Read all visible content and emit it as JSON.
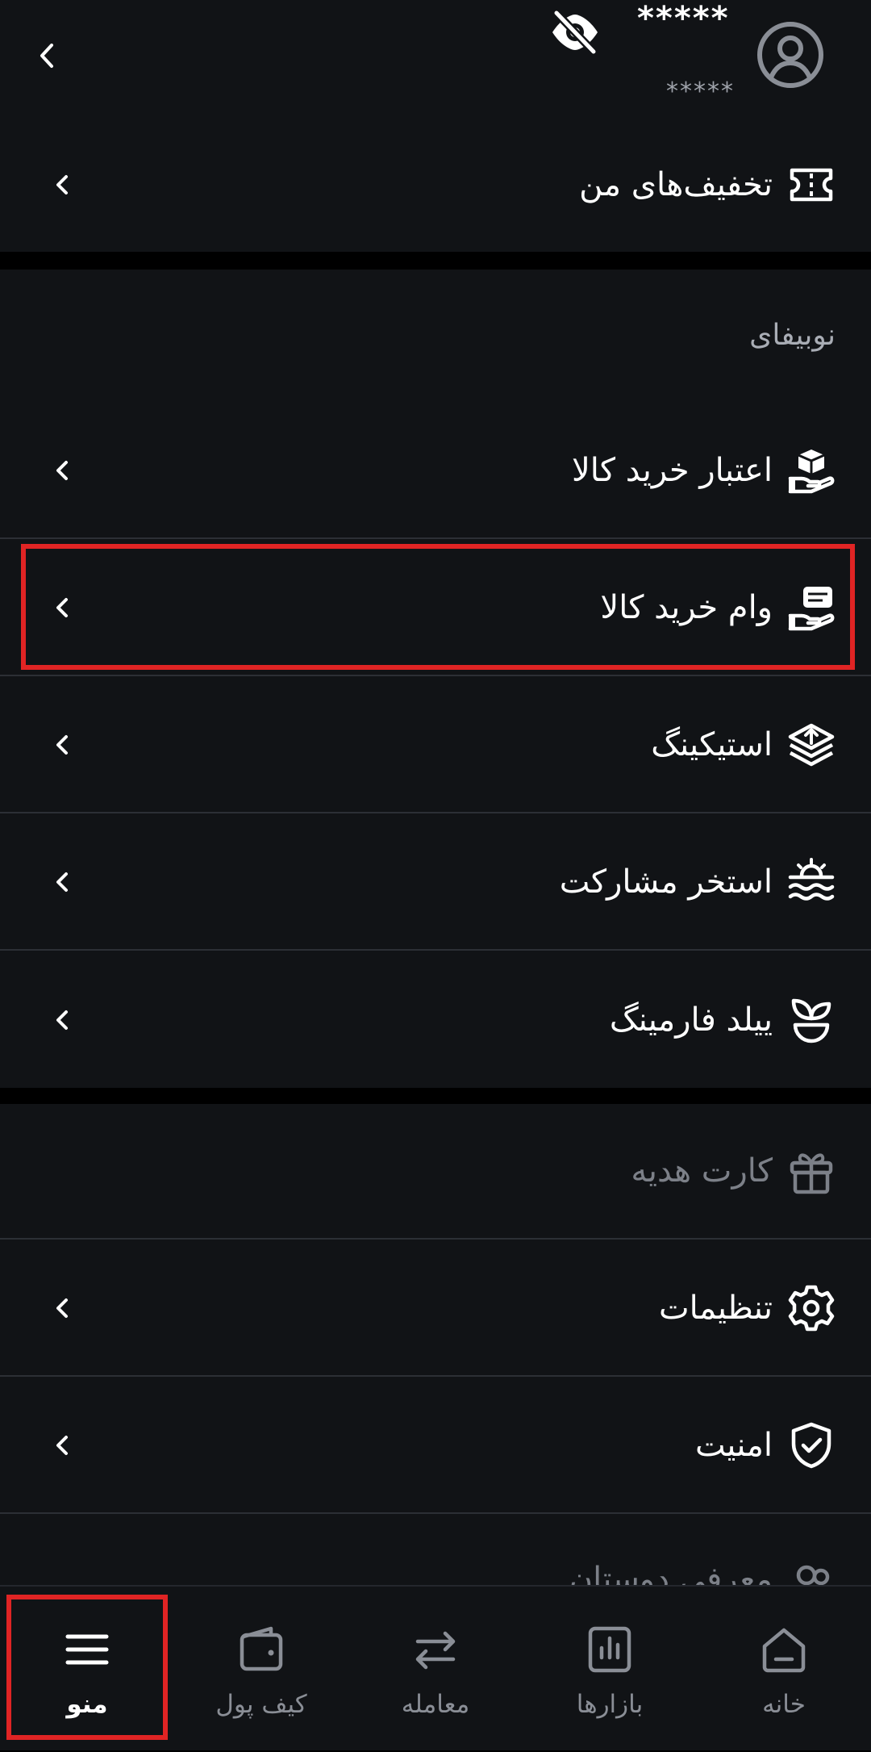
{
  "header": {
    "masked_name": "*****",
    "masked_id": "*****",
    "avatar_icon": "user-circle-icon",
    "visibility_icon": "eye-off-icon",
    "back_icon": "chevron-left-icon"
  },
  "discounts": {
    "label": "تخفیف‌های من",
    "icon": "ticket-icon"
  },
  "nobifi": {
    "section_title": "نوبیفای",
    "items": [
      {
        "label": "اعتبار خرید کالا",
        "icon": "hand-box-icon"
      },
      {
        "label": "وام خرید کالا",
        "icon": "hand-cash-icon"
      },
      {
        "label": "استیکینگ",
        "icon": "layers-up-icon"
      },
      {
        "label": "استخر مشارکت",
        "icon": "pool-waves-icon"
      },
      {
        "label": "ییلد فارمینگ",
        "icon": "sprout-icon"
      }
    ]
  },
  "general": {
    "items": [
      {
        "label": "کارت هدیه",
        "icon": "gift-icon",
        "disabled": true
      },
      {
        "label": "تنظیمات",
        "icon": "gear-icon"
      },
      {
        "label": "امنیت",
        "icon": "shield-check-icon"
      },
      {
        "label": "معرفی دوستان",
        "icon": "users-icon"
      }
    ]
  },
  "bottom_nav": {
    "items": [
      {
        "label": "منو",
        "icon": "menu-icon",
        "active": true
      },
      {
        "label": "کیف پول",
        "icon": "wallet-icon"
      },
      {
        "label": "معامله",
        "icon": "swap-icon"
      },
      {
        "label": "بازارها",
        "icon": "bar-chart-icon"
      },
      {
        "label": "خانه",
        "icon": "home-icon"
      }
    ]
  },
  "colors": {
    "background": "#000000",
    "panel": "#111316",
    "divider": "#2c2f35",
    "text": "#ffffff",
    "muted": "#8a8e96",
    "highlight": "#e02424"
  }
}
